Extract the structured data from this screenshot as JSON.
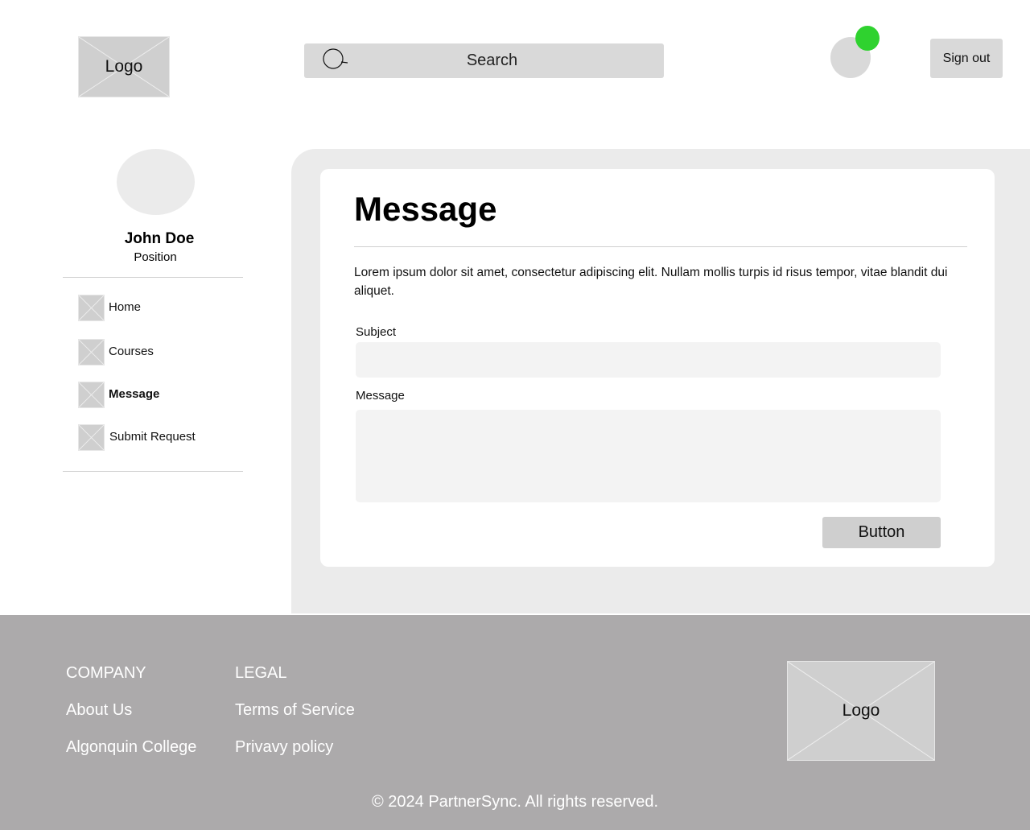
{
  "header": {
    "logo_label": "Logo",
    "search_placeholder": "Search",
    "signout_label": "Sign out",
    "notification_color": "#2fd22f"
  },
  "sidebar": {
    "name": "John Doe",
    "position": "Position",
    "items": [
      {
        "label": "Home",
        "icon": "image-placeholder-icon",
        "active": false
      },
      {
        "label": "Courses",
        "icon": "image-placeholder-icon",
        "active": false
      },
      {
        "label": "Message",
        "icon": "image-placeholder-icon",
        "active": true
      },
      {
        "label": "Submit Request",
        "icon": "image-placeholder-icon",
        "active": false
      }
    ]
  },
  "main": {
    "title": "Message",
    "intro": "Lorem ipsum dolor sit amet, consectetur adipiscing elit. Nullam mollis turpis id risus tempor, vitae blandit dui aliquet.",
    "subject_label": "Subject",
    "subject_value": "",
    "message_label": "Message",
    "message_value": "",
    "button_label": "Button"
  },
  "footer": {
    "company_heading": "COMPANY",
    "company_links": [
      "About Us",
      "Algonquin College"
    ],
    "legal_heading": "LEGAL",
    "legal_links": [
      "Terms of Service",
      "Privavy policy"
    ],
    "logo_label": "Logo",
    "copyright": "© 2024 PartnerSync. All rights reserved."
  }
}
